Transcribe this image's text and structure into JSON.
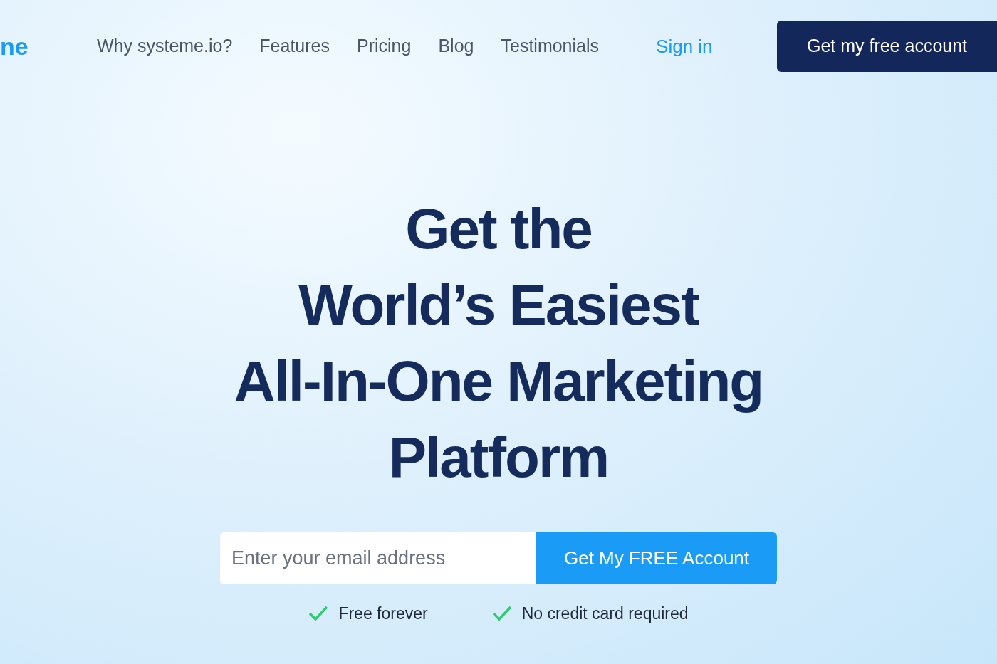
{
  "logo": "ne",
  "nav": [
    {
      "label": "Why systeme.io?"
    },
    {
      "label": "Features"
    },
    {
      "label": "Pricing"
    },
    {
      "label": "Blog"
    },
    {
      "label": "Testimonials"
    }
  ],
  "sign_in": "Sign in",
  "header_button": "Get my free account",
  "headline_lines": [
    "Get the",
    "World’s Easiest",
    "All-In-One Marketing",
    "Platform"
  ],
  "email": {
    "placeholder": "Enter your email address"
  },
  "cta": "Get My FREE Account",
  "perks": [
    "Free forever",
    "No credit card required"
  ]
}
